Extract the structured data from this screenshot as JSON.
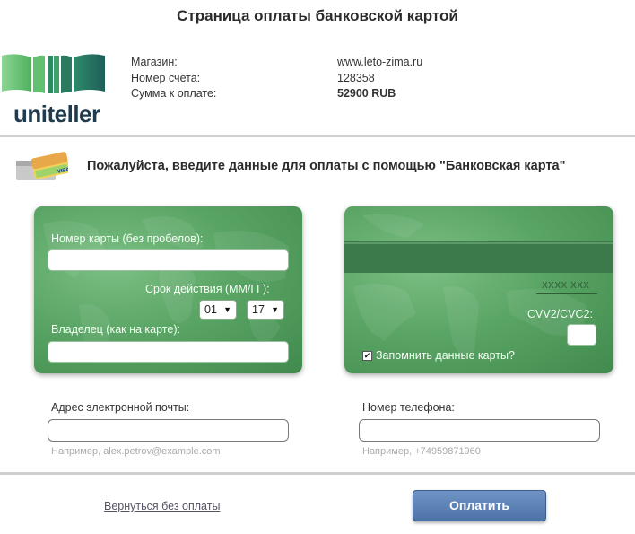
{
  "header": {
    "title": "Страница оплаты банковской картой"
  },
  "logo": {
    "text": "uniteller"
  },
  "order": {
    "shop_label": "Магазин:",
    "shop_value": "www.leto-zima.ru",
    "account_label": "Номер счета:",
    "account_value": "128358",
    "amount_label": "Сумма к оплате:",
    "amount_value": "52900 RUB"
  },
  "instruction": "Пожалуйста, введите данные для оплаты с помощью \"Банковская карта\"",
  "card_front": {
    "number_label": "Номер карты (без пробелов):",
    "number_value": "",
    "expiry_label": "Срок действия (ММ/ГГ):",
    "expiry_month": "01",
    "expiry_year": "17",
    "holder_label": "Владелец (как на карте):",
    "holder_value": ""
  },
  "card_back": {
    "signature_text": "XXXX XXX",
    "cvv_label": "CVV2/CVC2:",
    "cvv_value": "",
    "remember_label": "Запомнить данные карты?",
    "remember_checked": true
  },
  "contact": {
    "email_label": "Адрес электронной почты:",
    "email_value": "",
    "email_hint": "Например, alex.petrov@example.com",
    "phone_label": "Номер телефона:",
    "phone_value": "",
    "phone_hint": "Например, +74959871960"
  },
  "actions": {
    "back_label": "Вернуться без оплаты",
    "pay_label": "Оплатить"
  },
  "colors": {
    "card_green": "#5aa565",
    "pay_button_blue": "#5a7fb5",
    "logo_green": "#5fbf6b",
    "logo_dark": "#1f3b4d"
  },
  "icons": {
    "logo": "uniteller-logo-icon",
    "cards": "bank-cards-icon",
    "select_arrow": "chevron-down-icon",
    "checkbox": "checkmark-icon"
  }
}
